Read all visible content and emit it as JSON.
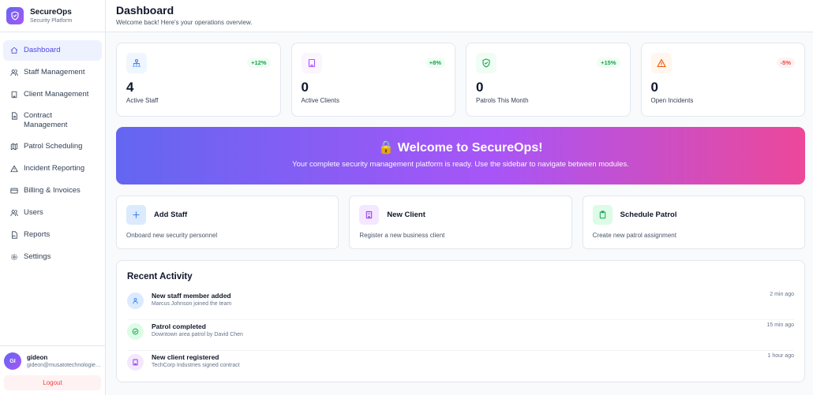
{
  "brand": {
    "name": "SecureOps",
    "subtitle": "Security Platform"
  },
  "nav": [
    {
      "label": "Dashboard",
      "icon": "home-icon",
      "active": true
    },
    {
      "label": "Staff Management",
      "icon": "users-icon"
    },
    {
      "label": "Client Management",
      "icon": "building-icon"
    },
    {
      "label": "Contract Management",
      "icon": "document-icon"
    },
    {
      "label": "Patrol Scheduling",
      "icon": "map-icon"
    },
    {
      "label": "Incident Reporting",
      "icon": "warning-icon"
    },
    {
      "label": "Billing & Invoices",
      "icon": "credit-card-icon"
    },
    {
      "label": "Users",
      "icon": "users-icon"
    },
    {
      "label": "Reports",
      "icon": "report-icon"
    },
    {
      "label": "Settings",
      "icon": "gear-icon"
    }
  ],
  "user": {
    "initials": "GI",
    "name": "gideon",
    "email": "gideon@musatotechnologies.com",
    "logout_label": "Logout"
  },
  "header": {
    "title": "Dashboard",
    "subtitle": "Welcome back! Here's your operations overview."
  },
  "stats": [
    {
      "value": "4",
      "label": "Active Staff",
      "change": "+12%",
      "icon": "staff-network-icon",
      "color": "#3b82f6",
      "bg": "#eff6ff"
    },
    {
      "value": "0",
      "label": "Active Clients",
      "change": "+8%",
      "icon": "building-icon",
      "color": "#a855f7",
      "bg": "#faf5ff"
    },
    {
      "value": "0",
      "label": "Patrols This Month",
      "change": "+15%",
      "icon": "shield-check-icon",
      "color": "#16a34a",
      "bg": "#f0fdf4"
    },
    {
      "value": "0",
      "label": "Open Incidents",
      "change": "-5%",
      "icon": "warning-icon",
      "color": "#ea580c",
      "bg": "#fff7ed"
    }
  ],
  "banner": {
    "emoji": "🔒",
    "title": "Welcome to SecureOps!",
    "text": "Your complete security management platform is ready. Use the sidebar to navigate between modules."
  },
  "actions": [
    {
      "title": "Add Staff",
      "desc": "Onboard new security personnel",
      "icon": "plus-icon",
      "color": "#3b82f6",
      "bg": "#dbeafe"
    },
    {
      "title": "New Client",
      "desc": "Register a new business client",
      "icon": "building-icon",
      "color": "#9333ea",
      "bg": "#f3e8ff"
    },
    {
      "title": "Schedule Patrol",
      "desc": "Create new patrol assignment",
      "icon": "clipboard-icon",
      "color": "#16a34a",
      "bg": "#dcfce7"
    }
  ],
  "activity": {
    "title": "Recent Activity",
    "items": [
      {
        "title": "New staff member added",
        "desc": "Marcus Johnson joined the team",
        "time": "2 min ago",
        "icon": "user-icon",
        "color": "#3b82f6",
        "bg": "#dbeafe"
      },
      {
        "title": "Patrol completed",
        "desc": "Downtown area patrol by David Chen",
        "time": "15 min ago",
        "icon": "check-circle-icon",
        "color": "#16a34a",
        "bg": "#dcfce7"
      },
      {
        "title": "New client registered",
        "desc": "TechCorp Industries signed contract",
        "time": "1 hour ago",
        "icon": "building-icon",
        "color": "#9333ea",
        "bg": "#f3e8ff"
      }
    ]
  },
  "colors": {
    "accent": "#4f46e5",
    "up": "#16a34a",
    "down": "#ef4444"
  }
}
